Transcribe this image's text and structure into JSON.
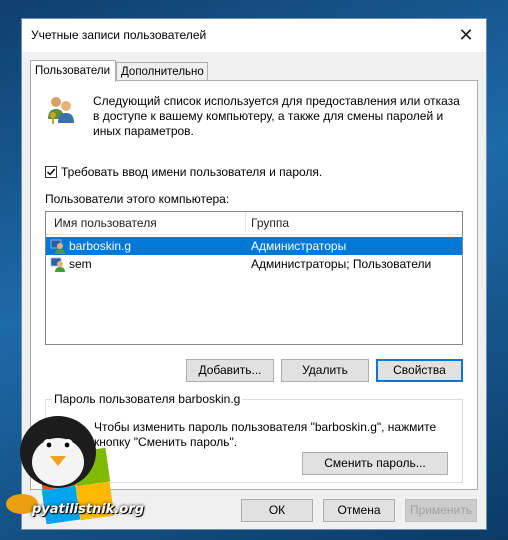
{
  "window": {
    "title": "Учетные записи пользователей"
  },
  "tabs": [
    {
      "label": "Пользователи",
      "active": true
    },
    {
      "label": "Дополнительно",
      "active": false
    }
  ],
  "description": "Следующий список используется для предоставления или отказа в доступе к вашему компьютеру, а также для смены паролей и иных параметров.",
  "require_password": {
    "label": "Требовать ввод имени пользователя и пароля.",
    "checked": true
  },
  "users_list": {
    "label": "Пользователи этого компьютера:",
    "columns": [
      "Имя пользователя",
      "Группа"
    ],
    "rows": [
      {
        "name": "barboskin.g",
        "group": "Администраторы",
        "selected": true
      },
      {
        "name": "sem",
        "group": "Администраторы; Пользователи",
        "selected": false
      }
    ]
  },
  "list_buttons": {
    "add": "Добавить...",
    "remove": "Удалить",
    "properties": "Свойства"
  },
  "password_group": {
    "title": "Пароль пользователя barboskin.g",
    "text": "Чтобы изменить пароль пользователя \"barboskin.g\", нажмите кнопку \"Сменить пароль\".",
    "button": "Сменить пароль..."
  },
  "footer_buttons": {
    "ok": "ОК",
    "cancel": "Отмена",
    "apply": "Применить"
  },
  "watermark": "pyatilistnik.org",
  "colors": {
    "selection": "#0078d7",
    "default_button_border": "#0078d7"
  }
}
